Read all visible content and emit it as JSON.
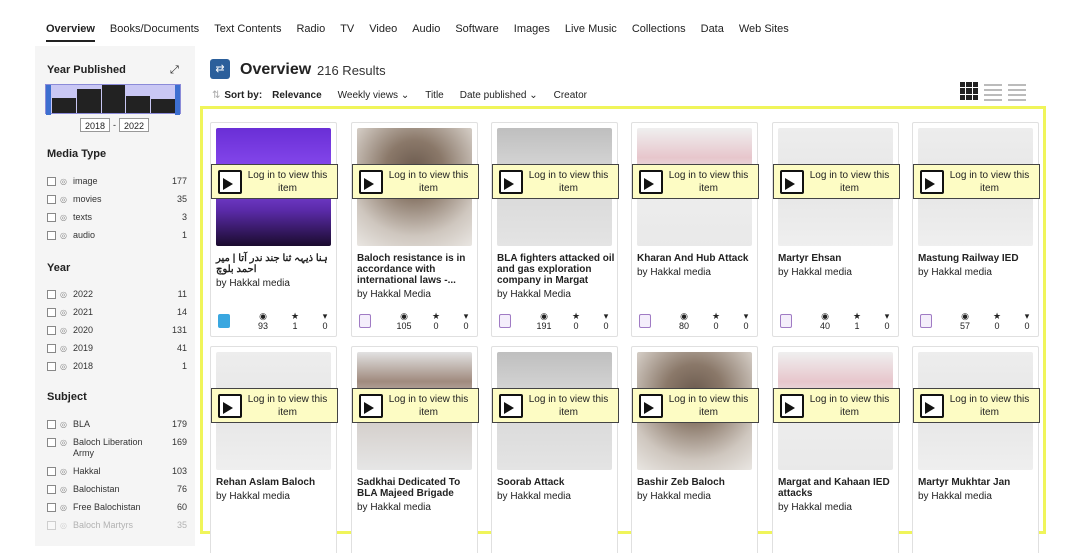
{
  "top_tabs": [
    {
      "label": "Overview",
      "active": true
    },
    {
      "label": "Books/Documents"
    },
    {
      "label": "Text Contents"
    },
    {
      "label": "Radio"
    },
    {
      "label": "TV"
    },
    {
      "label": "Video"
    },
    {
      "label": "Audio"
    },
    {
      "label": "Software"
    },
    {
      "label": "Images"
    },
    {
      "label": "Live Music"
    },
    {
      "label": "Collections"
    },
    {
      "label": "Data"
    },
    {
      "label": "Web Sites"
    }
  ],
  "sidebar": {
    "year_published": {
      "heading": "Year Published",
      "from": "2018",
      "to": "2022",
      "dash": "-",
      "histogram": [
        0.55,
        0.85,
        1.0,
        0.6,
        0.5
      ]
    },
    "media_type": {
      "heading": "Media Type",
      "items": [
        {
          "label": "image",
          "count": "177"
        },
        {
          "label": "movies",
          "count": "35"
        },
        {
          "label": "texts",
          "count": "3"
        },
        {
          "label": "audio",
          "count": "1"
        }
      ]
    },
    "year": {
      "heading": "Year",
      "items": [
        {
          "label": "2022",
          "count": "11"
        },
        {
          "label": "2021",
          "count": "14"
        },
        {
          "label": "2020",
          "count": "131"
        },
        {
          "label": "2019",
          "count": "41"
        },
        {
          "label": "2018",
          "count": "1"
        }
      ]
    },
    "subject": {
      "heading": "Subject",
      "items": [
        {
          "label": "BLA",
          "count": "179"
        },
        {
          "label": "Baloch Liberation Army",
          "count": "169"
        },
        {
          "label": "Hakkal",
          "count": "103"
        },
        {
          "label": "Balochistan",
          "count": "76"
        },
        {
          "label": "Free Balochistan",
          "count": "60"
        },
        {
          "label": "Baloch Martyrs",
          "count": "35"
        }
      ]
    }
  },
  "main": {
    "title": "Overview",
    "count_label": "216 Results",
    "sort_label": "Sort by:",
    "sort_options": [
      {
        "label": "Relevance",
        "active": true
      },
      {
        "label": "Weekly views ⌄"
      },
      {
        "label": "Title"
      },
      {
        "label": "Date published ⌄"
      },
      {
        "label": "Creator"
      }
    ]
  },
  "login_text": "Log in to view this item",
  "colors": {
    "highlight_border": "#f0f55a",
    "login_bg": "#fdfcc4",
    "header_icon": "#2b5f9b"
  },
  "cards": [
    {
      "title": "ہنا ذیہہ ثنا جند ندر آتا | میر احمد بلوچ",
      "by": "by Hakkal media",
      "type": "audio",
      "views": "93",
      "favs": "1",
      "reviews": "0",
      "rtl": true,
      "thumb": "purple"
    },
    {
      "title": "Baloch resistance is in accordance with international laws -...",
      "by": "by Hakkal Media",
      "type": "image",
      "views": "105",
      "favs": "0",
      "reviews": "0",
      "thumb": "face"
    },
    {
      "title": "BLA fighters attacked oil and gas exploration company in Margat",
      "by": "by Hakkal Media",
      "type": "image",
      "views": "191",
      "favs": "0",
      "reviews": "0",
      "thumb": "gray"
    },
    {
      "title": "Kharan And Hub Attack",
      "by": "by Hakkal media",
      "type": "image",
      "views": "80",
      "favs": "0",
      "reviews": "0",
      "thumb": "pink"
    },
    {
      "title": "Martyr Ehsan",
      "by": "by Hakkal media",
      "type": "image",
      "views": "40",
      "favs": "1",
      "reviews": "0",
      "thumb": "light"
    },
    {
      "title": "Mastung Railway IED",
      "by": "by Hakkal media",
      "type": "image",
      "views": "57",
      "favs": "0",
      "reviews": "0",
      "thumb": "light"
    },
    {
      "title": "Rehan Aslam Baloch",
      "by": "by Hakkal media",
      "thumb": "light"
    },
    {
      "title": "Sadkhai Dedicated To BLA Majeed Brigade",
      "by": "by Hakkal media",
      "thumb": "brown"
    },
    {
      "title": "Soorab Attack",
      "by": "by Hakkal media",
      "thumb": "gray"
    },
    {
      "title": "Bashir Zeb Baloch",
      "by": "by Hakkal media",
      "thumb": "face"
    },
    {
      "title": "Margat and Kahaan IED attacks",
      "by": "by Hakkal media",
      "thumb": "pink"
    },
    {
      "title": "Martyr Mukhtar Jan",
      "by": "by Hakkal media",
      "thumb": "light"
    }
  ]
}
